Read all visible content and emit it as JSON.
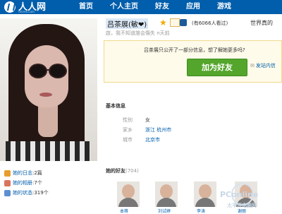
{
  "header": {
    "logo_text": "人人网",
    "logo_subtext": "renren.com",
    "nav": [
      "首页",
      "个人主页",
      "好友",
      "应用",
      "游戏"
    ]
  },
  "profile": {
    "name": "吕茶展(敏❤)",
    "visits": "(有6066人看过)",
    "world_label": "世界真的",
    "status": "啟，我不知道誰会傷失",
    "status_time": "n天前",
    "privacy_notice": "吕茶展只公开了一部分信息，想了解她更多吗?",
    "add_friend_button": "加为好友",
    "send_message": "发站内信"
  },
  "basic_info": {
    "title": "基本信息",
    "rows": [
      {
        "label": "性别",
        "value": "女"
      },
      {
        "label": "家乡",
        "value": "浙江 杭州市"
      },
      {
        "label": "城市",
        "value": "北京市"
      }
    ]
  },
  "left_links": [
    {
      "label": "她的日志",
      "count": ":2篇",
      "color": "#e89d2f"
    },
    {
      "label": "她的相册",
      "count": ":7个",
      "color": "#d9745f"
    },
    {
      "label": "她的状态",
      "count": ":319个",
      "color": "#5d8fd1"
    }
  ],
  "friends": {
    "title": "她的好友",
    "count": "(704)",
    "names": [
      "本蒋",
      "刘试婷",
      "李涛",
      "谢丽"
    ]
  },
  "watermark": {
    "text": "PConline",
    "subtext": "太平洋电脑网"
  },
  "colors": {
    "header": "#005eac",
    "accent_link": "#005eac",
    "add_button": "#54a52c",
    "notice_background": "#fffbea"
  },
  "icons": [
    "logo-icon",
    "star-icon",
    "vip-icon",
    "mail-icon"
  ]
}
